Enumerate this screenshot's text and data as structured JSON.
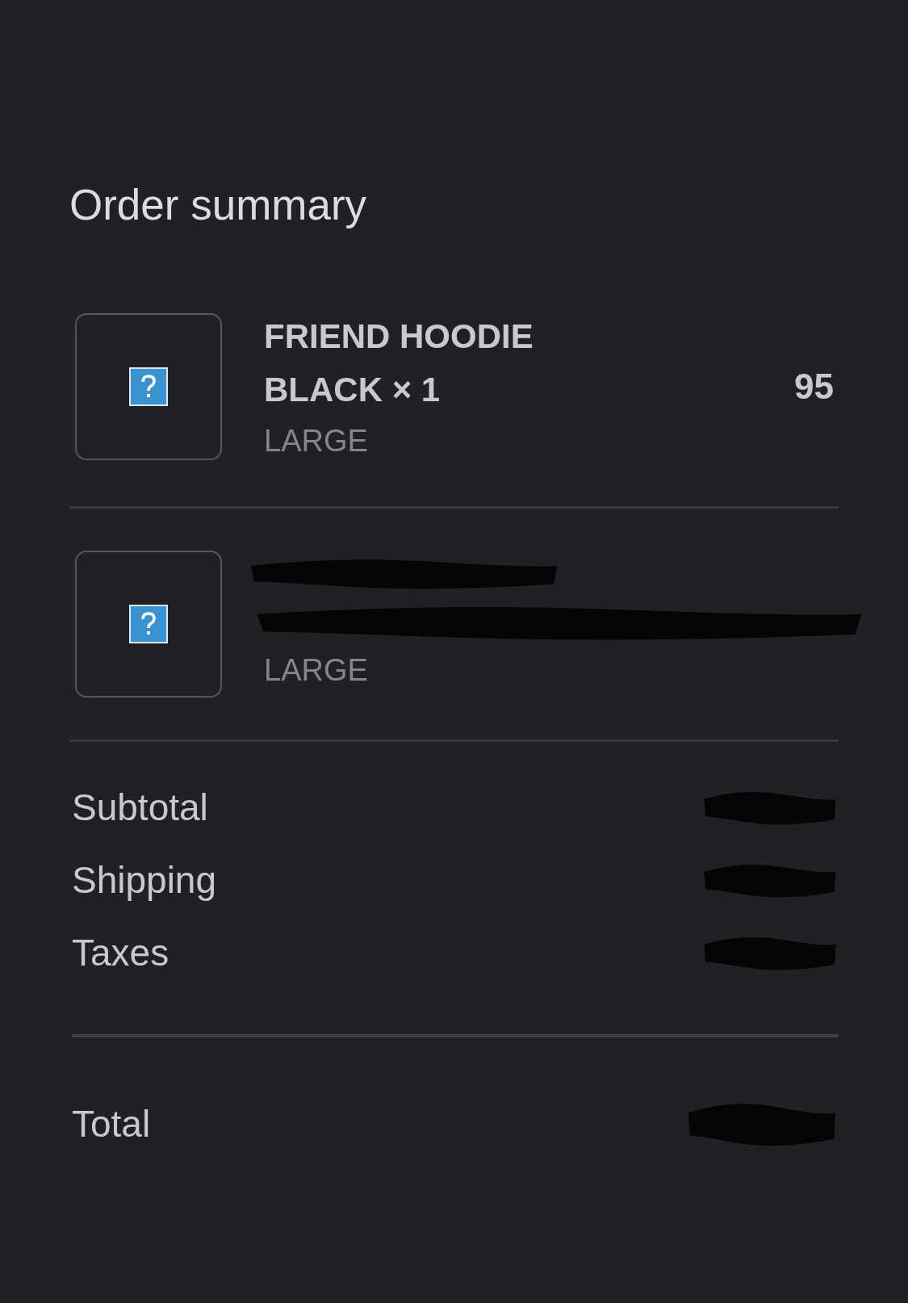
{
  "title": "Order summary",
  "items": [
    {
      "name": "FRIEND HOODIE BLACK × 1",
      "variant": "LARGE",
      "price": "95",
      "redacted": false
    },
    {
      "variant": "LARGE",
      "redacted": true
    }
  ],
  "summary": [
    {
      "label": "Subtotal",
      "redacted": true
    },
    {
      "label": "Shipping",
      "redacted": true
    },
    {
      "label": "Taxes",
      "redacted": true
    }
  ],
  "total": {
    "label": "Total",
    "redacted": true
  }
}
